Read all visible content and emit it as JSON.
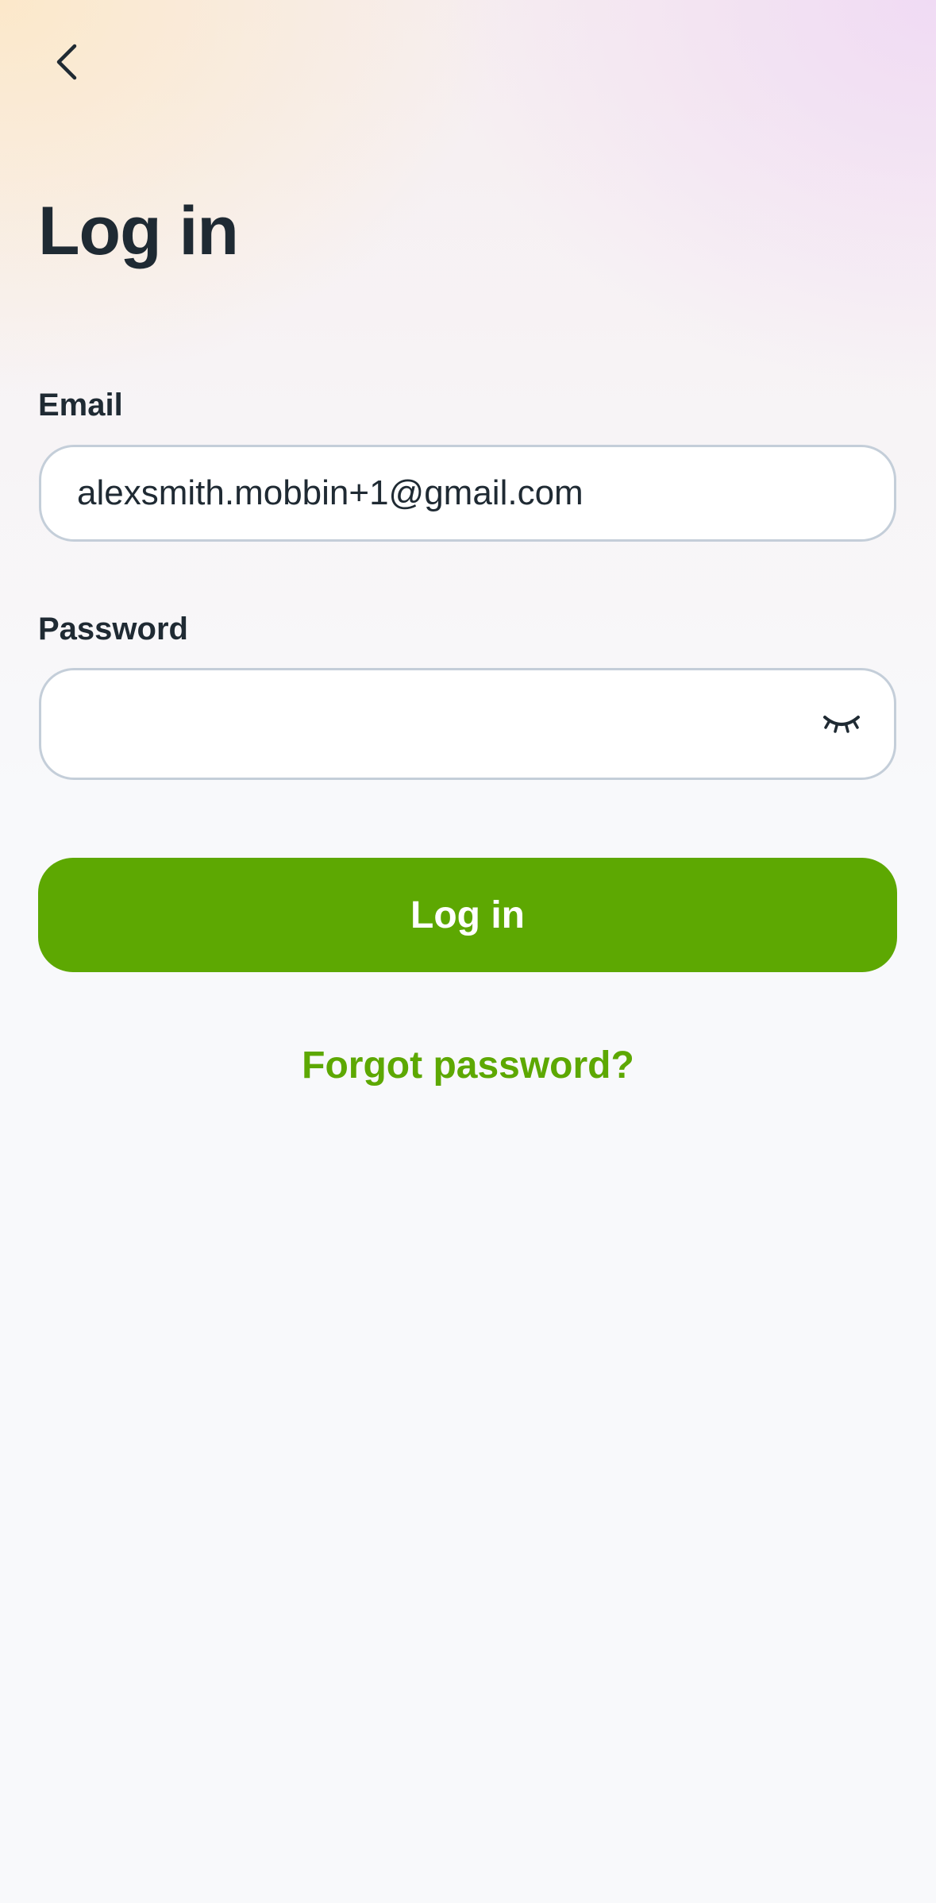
{
  "header": {
    "back_icon": "chevron-left-icon",
    "title": "Log in"
  },
  "form": {
    "email": {
      "label": "Email",
      "value": "alexsmith.mobbin+1@gmail.com",
      "placeholder": ""
    },
    "password": {
      "label": "Password",
      "value": "",
      "placeholder": "",
      "toggle_icon": "eye-closed-icon"
    },
    "submit_label": "Log in",
    "forgot_label": "Forgot password?"
  },
  "colors": {
    "accent": "#5da802",
    "text": "#1f2a33",
    "input_border": "#c4ced9"
  }
}
